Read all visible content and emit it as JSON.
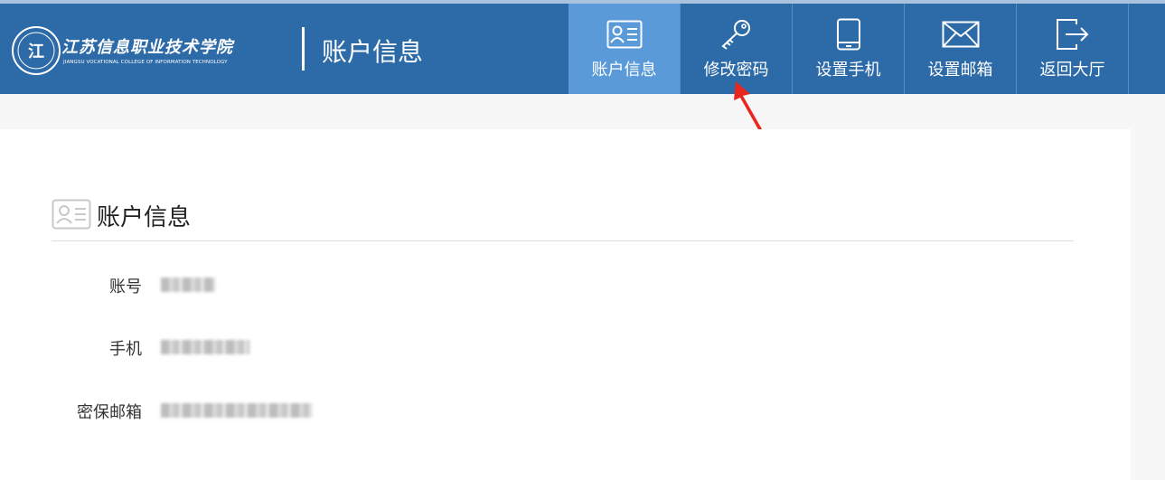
{
  "header": {
    "school_name_cn": "江苏信息职业技术学院",
    "school_name_en": "JIANGSU VOCATIONAL COLLEGE OF INFORMATION TECHNOLOGY",
    "page_title": "账户信息",
    "bg_color": "#2d6aa8",
    "active_color": "#5b9ad8"
  },
  "nav": {
    "items": [
      {
        "label": "账户信息",
        "icon": "id-card-icon",
        "active": true
      },
      {
        "label": "修改密码",
        "icon": "key-icon",
        "active": false
      },
      {
        "label": "设置手机",
        "icon": "phone-icon",
        "active": false
      },
      {
        "label": "设置邮箱",
        "icon": "envelope-icon",
        "active": false
      },
      {
        "label": "返回大厅",
        "icon": "exit-icon",
        "active": false
      }
    ]
  },
  "annotation": {
    "color": "#e8271f"
  },
  "content": {
    "section_title": "账户信息",
    "fields": [
      {
        "label": "账号"
      },
      {
        "label": "手机"
      },
      {
        "label": "密保邮箱"
      }
    ]
  }
}
